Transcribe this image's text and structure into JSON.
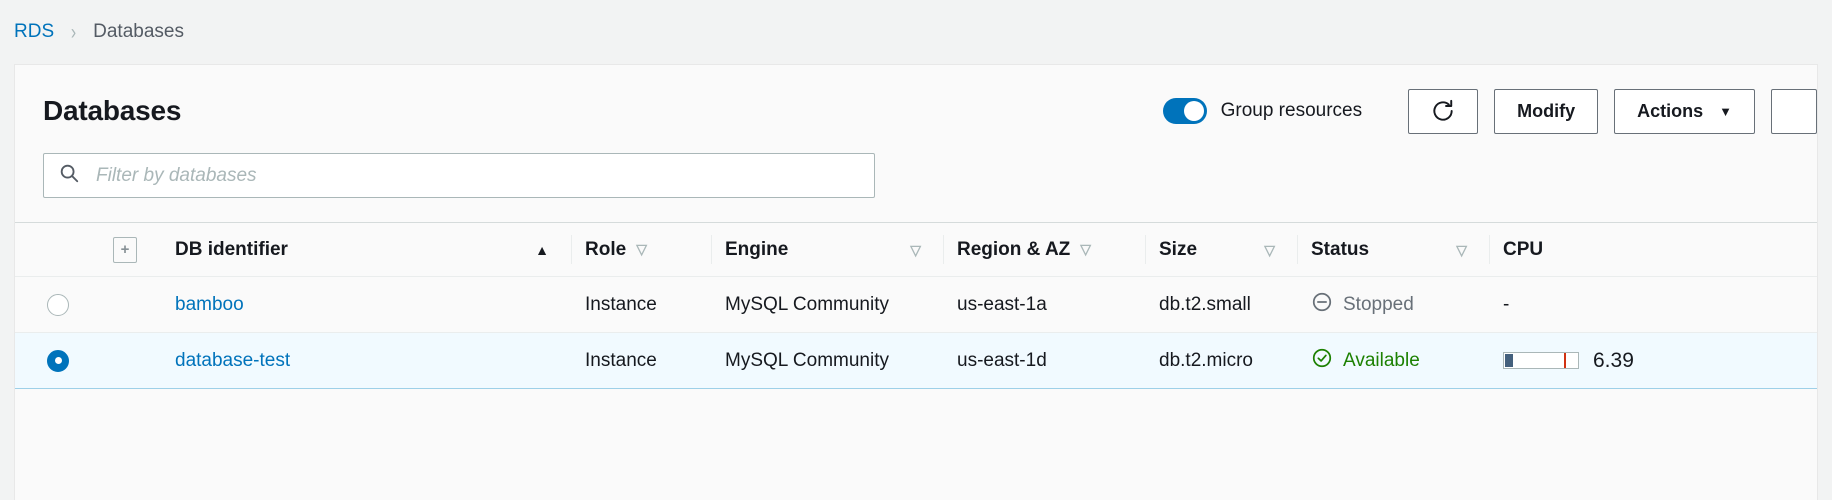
{
  "breadcrumb": {
    "root": "RDS",
    "separator": "›",
    "current": "Databases"
  },
  "panel": {
    "title": "Databases",
    "group_toggle": {
      "label": "Group resources",
      "enabled": true,
      "accent_color": "#0073bb"
    },
    "buttons": {
      "refresh": "refresh-icon",
      "modify": "Modify",
      "actions": "Actions",
      "actions_caret": "▼"
    },
    "search": {
      "placeholder": "Filter by databases",
      "value": "",
      "icon": "search-icon"
    }
  },
  "table": {
    "expand_all_icon": "+",
    "columns": [
      {
        "label": "DB identifier",
        "sort": "asc",
        "caret": "▲"
      },
      {
        "label": "Role",
        "sort": "none",
        "caret": "▽"
      },
      {
        "label": "Engine",
        "sort": "none",
        "caret": "▽"
      },
      {
        "label": "Region & AZ",
        "sort": "none",
        "caret": "▽"
      },
      {
        "label": "Size",
        "sort": "none",
        "caret": "▽"
      },
      {
        "label": "Status",
        "sort": "none",
        "caret": "▽"
      },
      {
        "label": "CPU",
        "sort": "none",
        "caret": ""
      }
    ],
    "rows": [
      {
        "selected": false,
        "db_identifier": "bamboo",
        "role": "Instance",
        "engine": "MySQL Community",
        "region_az": "us-east-1a",
        "size": "db.t2.small",
        "status": "Stopped",
        "status_kind": "stopped",
        "status_color": "#687078",
        "cpu_text": "-",
        "cpu_percent": null
      },
      {
        "selected": true,
        "db_identifier": "database-test",
        "role": "Instance",
        "engine": "MySQL Community",
        "region_az": "us-east-1d",
        "size": "db.t2.micro",
        "status": "Available",
        "status_kind": "available",
        "status_color": "#1d8102",
        "cpu_text": "6.39",
        "cpu_percent": 6.39
      }
    ]
  }
}
